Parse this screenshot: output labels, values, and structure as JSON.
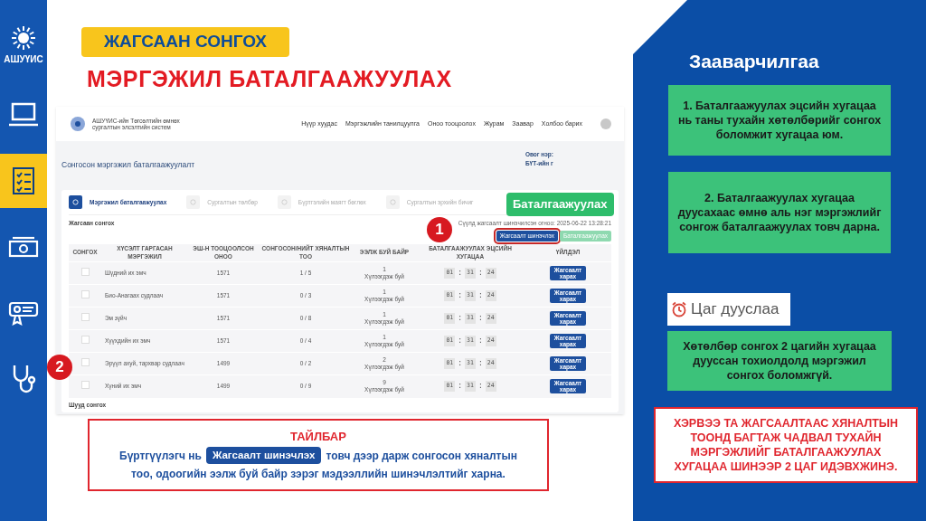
{
  "sidebar": {
    "logo_text": "АШУҮИС",
    "items": [
      {
        "kind": "laptop",
        "selected": false
      },
      {
        "kind": "checklist",
        "selected": true
      },
      {
        "kind": "money",
        "selected": false
      },
      {
        "kind": "ticket",
        "selected": false
      },
      {
        "kind": "stethoscope",
        "selected": false
      }
    ]
  },
  "title_badge": "ЖАГСААН СОНГОХ",
  "title": "МЭРГЭЖИЛ БАТАЛГААЖУУЛАХ",
  "screenshot": {
    "logo_lines": [
      "АШУҮИС-ийн Төгсөлтийн өмнөх",
      "сургалтын элсэлтийн систем"
    ],
    "nav": [
      "Нүүр хуудас",
      "Мэргэжлийн танилцуулга",
      "Оноо тооцоолох",
      "Журам",
      "Заавар",
      "Холбоо барих"
    ],
    "page_title": "Сонгосон мэргэжил баталгаажуулалт",
    "user_lines": [
      "Овог нэр:",
      "БҮТ-ийн г"
    ],
    "steps": [
      {
        "label": "Мэргэжил баталгаажуулах",
        "selected": true
      },
      {
        "label": "Сургалтын төлбөр",
        "selected": false
      },
      {
        "label": "Бүртгэлийн маягт бөглөх",
        "selected": false
      },
      {
        "label": "Сургалтын эрхийн бичиг",
        "selected": false
      }
    ],
    "section": "Жагсаан сонгох",
    "updated": "Сүүлд жагсаалт шинэчилсэн огноо: 2025-06-22 13:28:21",
    "refresh_button": "Жагсаалт шинэчлэх",
    "confirm_button": {
      "label": "Баталгаажуулах",
      "disabled": true
    },
    "columns": [
      "СОНГОХ",
      "ХҮСЭЛТ ГАРГАСАН МЭРГЭЖИЛ",
      "ЭШ-Н ТООЦООЛСОН ОНОО",
      "СОНГОСОН/НИЙТ ХЯНАЛТЫН ТОО",
      "ЭЭЛЖ БУЙ БАЙР",
      "БАТАЛГААЖУУЛАХ ЭЦСИЙН ХУГАЦАА",
      "ҮЙЛДЭЛ"
    ],
    "rows": [
      {
        "checked": false,
        "name": "Шүдний их эмч",
        "score": "1571",
        "ratio": "1 / 5",
        "place": "1",
        "place_label": "Хүлээгдэж буй",
        "timer": [
          "01",
          ":",
          "31",
          ":",
          "24"
        ],
        "action": "Жагсаалт харах"
      },
      {
        "checked": false,
        "name": "Био-Анагаах судлаач",
        "score": "1571",
        "ratio": "0 / 3",
        "place": "1",
        "place_label": "Хүлээгдэж буй",
        "timer": [
          "01",
          ":",
          "31",
          ":",
          "24"
        ],
        "action": "Жагсаалт харах"
      },
      {
        "checked": false,
        "name": "Эм зүйч",
        "score": "1571",
        "ratio": "0 / 8",
        "place": "1",
        "place_label": "Хүлээгдэж буй",
        "timer": [
          "01",
          ":",
          "31",
          ":",
          "24"
        ],
        "action": "Жагсаалт харах"
      },
      {
        "checked": false,
        "name": "Хүүхдийн их эмч",
        "score": "1571",
        "ratio": "0 / 4",
        "place": "1",
        "place_label": "Хүлээгдэж буй",
        "timer": [
          "01",
          ":",
          "31",
          ":",
          "24"
        ],
        "action": "Жагсаалт харах"
      },
      {
        "checked": false,
        "name": "Эрүүл ахуй, тархвар судлаач",
        "score": "1499",
        "ratio": "0 / 2",
        "place": "2",
        "place_label": "Хүлээгдэж буй",
        "timer": [
          "01",
          ":",
          "31",
          ":",
          "24"
        ],
        "action": "Жагсаалт харах"
      },
      {
        "checked": false,
        "name": "Хүний их эмч",
        "score": "1499",
        "ratio": "0 / 9",
        "place": "9",
        "place_label": "Хүлээгдэж буй",
        "timer": [
          "01",
          ":",
          "31",
          ":",
          "24"
        ],
        "action": "Жагсаалт харах"
      }
    ],
    "next_section": "Шууд сонгох"
  },
  "callout_button": "Баталгаажуулах",
  "markers": [
    "1",
    "2"
  ],
  "note": {
    "title": "ТАЙЛБАР",
    "before": "Бүртгүүлэгч нь",
    "button": "Жагсаалт шинэчлэх",
    "after": "товч дээр дарж сонгосон хяналтын",
    "line2": "тоо, одоогийн ээлж буй байр зэрэг мэдээллийн шинэчлэлтийг харна."
  },
  "panel": {
    "heading": "Зааварчилгаа",
    "instructions": [
      "1. Баталгаажуулах эцсийн хугацаа нь таны тухайн хөтөлбөрийг сонгох боломжит хугацаа юм.",
      "2. Баталгаажуулах хугацаа дуусахаас өмнө аль нэг мэргэжлийг сонгож баталгаажуулах товч дарна."
    ],
    "timer_badge": "Цаг дууслаа",
    "expired_note": "Хөтөлбөр сонгох 2 цагийн хугацаа дууссан тохиолдолд мэргэжил сонгох боломжгүй.",
    "warning": "ХЭРВЭЭ ТА ЖАГСААЛТААС ХЯНАЛТЫН ТООНД БАГТАЖ ЧАДВАЛ ТУХАЙН МЭРГЭЖЛИЙГ БАТАЛГААЖУУЛАХ ХУГАЦАА ШИНЭЭР 2 ЦАГ ИДЭВХЖИНЭ."
  }
}
